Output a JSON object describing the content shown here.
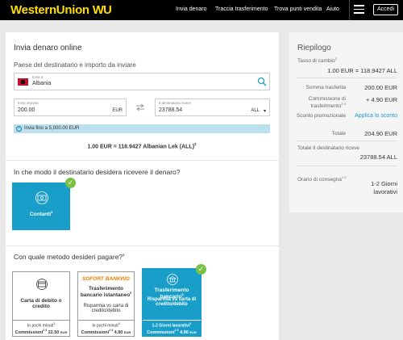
{
  "header": {
    "logo_text": "WesternUnion",
    "logo_mark": "WU",
    "nav": [
      "Invia denaro",
      "Traccia trasferimento",
      "Trova punti vendita",
      "Aiuto"
    ],
    "login": "Accedi"
  },
  "form": {
    "title": "Invia denaro online",
    "subtitle": "Paese del destinatario e importo da inviare",
    "country_label": "Invia a",
    "country_value": "Albania",
    "send_label": "Invia importo",
    "send_value": "200.00",
    "send_currency": "EUR",
    "receive_label": "Il destinatario riceve",
    "receive_value": "23788.54",
    "receive_currency": "ALL",
    "info_text": "Invia fino a 5,000.00 EUR",
    "rate_text": "1.00 EUR = 118.9427 Albanian Lek (ALL)",
    "rate_sup": "2",
    "receive_question": "In che modo il destinatario desidera ricevere il denaro?",
    "receive_option": "Contanti",
    "receive_option_sup": "3",
    "pay_question": "Con quale metodo desideri pagare?",
    "pay_question_sup": "4",
    "pay_options": [
      {
        "title": "Carta di debito o credito",
        "time": "In pochi minuti",
        "time_sup": "3",
        "fee_label": "Commissioni",
        "fee_sup": "2 3",
        "fee": "22.50",
        "cur": "EUR"
      },
      {
        "logo": "SOFORT BANKING",
        "title": "Trasferimento bancario istantaneo",
        "title_sup": "5",
        "sub": "Risparmia vs carta di credito/debito",
        "time": "In pochi minuti",
        "time_sup": "3",
        "fee_label": "Commissioni",
        "fee_sup": "2 3",
        "fee": "4.90",
        "cur": "EUR"
      },
      {
        "title": "Trasferimento bancario",
        "title_sup": "6",
        "sub": "Risparmia vs carta di credito/debito",
        "time": "1-2 Giorni lavorativi",
        "time_sup": "3",
        "fee_label": "Commissioni",
        "fee_sup": "2 3",
        "fee": "4.90",
        "cur": "EUR"
      }
    ]
  },
  "summary": {
    "title": "Riepilogo",
    "rate_label": "Tasso di cambio",
    "rate_sup": "2",
    "rate_value": "1.00 EUR = 118.9427 ALL",
    "transfer_label": "Somma trasferita",
    "transfer_value": "200.00",
    "transfer_cur": "EUR",
    "fee_label": "Commissione di trasferimento",
    "fee_sup": "2 3",
    "fee_value": "+ 4.90",
    "fee_cur": "EUR",
    "discount_label": "Sconto promozionale",
    "discount_action": "Applica lo sconto",
    "total_label": "Totale",
    "total_value": "204.90",
    "total_cur": "EUR",
    "receiver_label": "Totale Il destinatario riceve",
    "receiver_value": "23788.54 ALL",
    "delivery_label": "Orario di consegna",
    "delivery_sup": "1 2",
    "delivery_value": "1-2 Giorni lavorativi"
  },
  "colors": {
    "accent": "#199ec9",
    "check": "#7ac143",
    "logo": "#ffdd00",
    "info": "#bde0ef"
  }
}
